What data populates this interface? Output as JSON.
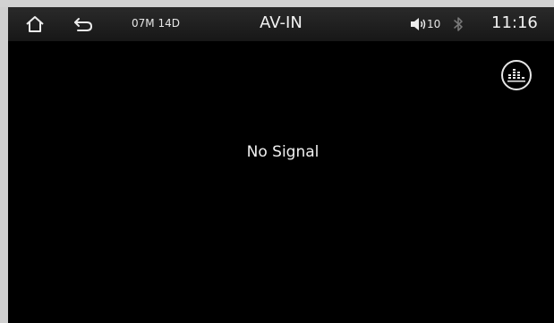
{
  "statusbar": {
    "home_icon": "home-icon",
    "back_icon": "back-arrow-icon",
    "date": "07M 14D",
    "title": "AV-IN",
    "volume_icon": "speaker-icon",
    "volume_level": "10",
    "bluetooth_icon": "bluetooth-icon",
    "time": "11:16"
  },
  "main": {
    "message": "No Signal",
    "equalizer_icon": "equalizer-icon"
  },
  "colors": {
    "background": "#000000",
    "statusbar": "#1f1f1f",
    "text": "#f0f0f0",
    "bluetooth_inactive": "#7a7a7a"
  }
}
